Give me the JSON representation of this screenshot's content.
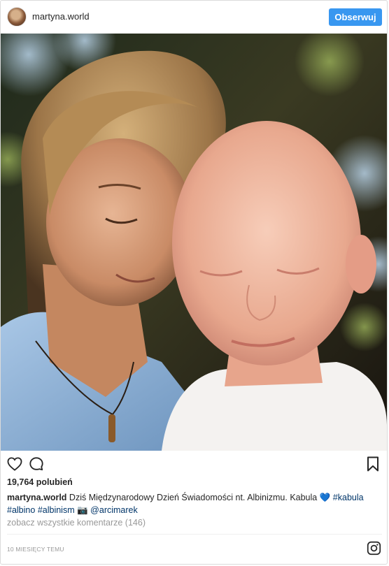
{
  "header": {
    "username": "martyna.world",
    "follow_label": "Obserwuj"
  },
  "photo": {
    "description_icon": "post-photo"
  },
  "actions": {
    "like_icon": "heart-outline-icon",
    "comment_icon": "comment-bubble-icon",
    "save_icon": "bookmark-icon"
  },
  "likes": "19,764 polubień",
  "caption": {
    "username": "martyna.world",
    "text_before": "Dziś Międzynarodowy Dzień Świadomości nt. Albinizmu. Kabula",
    "emoji": "💙",
    "hashtag_1": "#kabula",
    "hashtag_2": "#albino",
    "hashtag_3": "#albinism",
    "camera": "📷",
    "mention": "@arcimarek"
  },
  "view_comments": "zobacz wszystkie komentarze (146)",
  "timestamp": "10 miesięcy temu",
  "colors": {
    "accent": "#3897f0",
    "link": "#003569",
    "muted": "#999999",
    "text": "#262626"
  }
}
